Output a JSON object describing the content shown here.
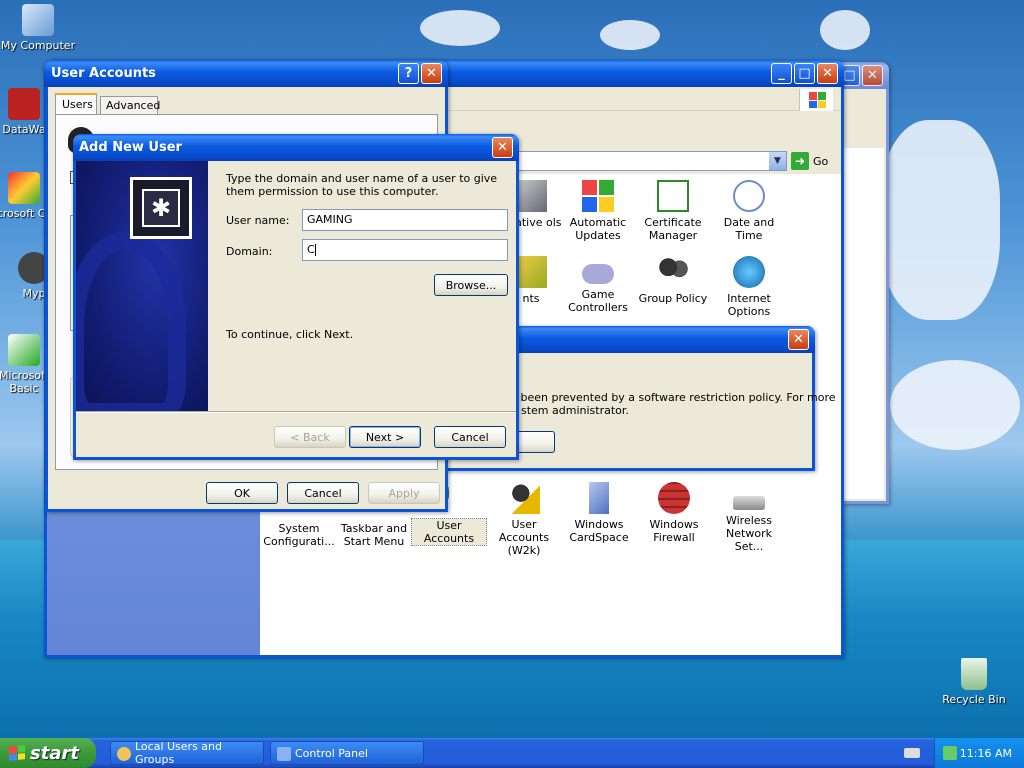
{
  "desktop": {
    "icons": [
      {
        "label": "My Computer"
      },
      {
        "label": "DataWa"
      },
      {
        "label": "Microsoft C++"
      },
      {
        "label": "Myp"
      },
      {
        "label": "Microsoft Basic"
      },
      {
        "label": "Recycle Bin"
      }
    ]
  },
  "control_panel": {
    "go_label": "Go",
    "items": [
      {
        "label": "strative ols",
        "icon": "admin-tools-icon"
      },
      {
        "label": "Automatic Updates",
        "icon": "windows-flag-icon"
      },
      {
        "label": "Certificate Manager",
        "icon": "certificate-icon"
      },
      {
        "label": "Date and Time",
        "icon": "clock-icon"
      },
      {
        "label": "nts",
        "icon": "fonts-icon"
      },
      {
        "label": "Game Controllers",
        "icon": "gamepad-icon"
      },
      {
        "label": "Group Policy",
        "icon": "users-icon"
      },
      {
        "label": "Internet Options",
        "icon": "globe-icon"
      },
      {
        "label": "System Configurati...",
        "icon": "system-icon"
      },
      {
        "label": "Taskbar and Start Menu",
        "icon": "taskbar-icon"
      },
      {
        "label": "User Accounts",
        "icon": "user-accounts-icon"
      },
      {
        "label": "User Accounts (W2k)",
        "icon": "user-key-icon"
      },
      {
        "label": "Windows CardSpace",
        "icon": "cardspace-icon"
      },
      {
        "label": "Windows Firewall",
        "icon": "firewall-icon"
      },
      {
        "label": "Wireless Network Set...",
        "icon": "wireless-icon"
      }
    ]
  },
  "restriction_dialog": {
    "message_line1": " been prevented by a software restriction policy. For more",
    "message_line2": "stem administrator."
  },
  "user_accounts": {
    "title": "User Accounts",
    "tabs": [
      {
        "label": "Users"
      },
      {
        "label": "Advanced"
      }
    ],
    "ok_label": "OK",
    "cancel_label": "Cancel",
    "apply_label": "Apply"
  },
  "add_user": {
    "title": "Add New User",
    "instruction": "Type the domain and user name of a user to give them permission to use this computer.",
    "username_label": "User name:",
    "username_value": "GAMING",
    "domain_label": "Domain:",
    "domain_value": "C",
    "browse_label": "Browse...",
    "continue_text": "To continue, click Next.",
    "back_label": "< Back",
    "next_label": "Next >",
    "cancel_label": "Cancel"
  },
  "taskbar": {
    "start_label": "start",
    "tasks": [
      {
        "label": "Local Users and Groups"
      },
      {
        "label": "Control Panel"
      }
    ],
    "clock": "11:16 AM"
  },
  "colors": {
    "title_active": "#0a5be0",
    "title_inactive": "#7f9ae0",
    "start_green": "#3c9a3a"
  }
}
